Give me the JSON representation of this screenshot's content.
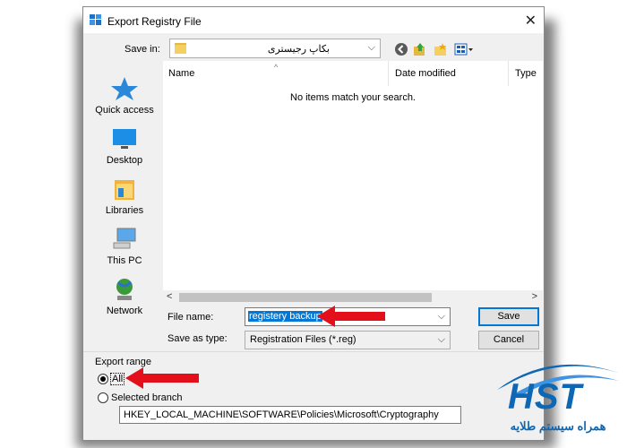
{
  "dialog": {
    "title": "Export Registry File",
    "close_glyph": "✕"
  },
  "toolbar": {
    "save_in_label": "Save in:",
    "save_in_value": "بکاپ رجیستری",
    "icons": [
      "back-icon",
      "up-folder-icon",
      "new-folder-icon",
      "view-menu-icon"
    ]
  },
  "places": [
    {
      "label": "Quick access",
      "icon": "quick-access-star-icon"
    },
    {
      "label": "Desktop",
      "icon": "desktop-icon"
    },
    {
      "label": "Libraries",
      "icon": "libraries-icon"
    },
    {
      "label": "This PC",
      "icon": "this-pc-icon"
    },
    {
      "label": "Network",
      "icon": "network-icon"
    }
  ],
  "filelist": {
    "columns": [
      "Name",
      "Date modified",
      "Type"
    ],
    "empty_message": "No items match your search."
  },
  "form": {
    "file_name_label": "File name:",
    "file_name_value": "registery backup",
    "save_as_type_label": "Save as type:",
    "save_as_type_value": "Registration Files (*.reg)",
    "save_button": "Save",
    "cancel_button": "Cancel"
  },
  "export_range": {
    "label": "Export range",
    "all_label": "All",
    "selected_branch_label": "Selected branch",
    "branch_value": "HKEY_LOCAL_MACHINE\\SOFTWARE\\Policies\\Microsoft\\Cryptography",
    "selected_option": "All"
  },
  "logo": {
    "text": "HST",
    "tagline": "همراه سیستم طلایه"
  },
  "colors": {
    "accent": "#0078d7",
    "arrow": "#e3101b",
    "logo": "#0d67b5"
  }
}
